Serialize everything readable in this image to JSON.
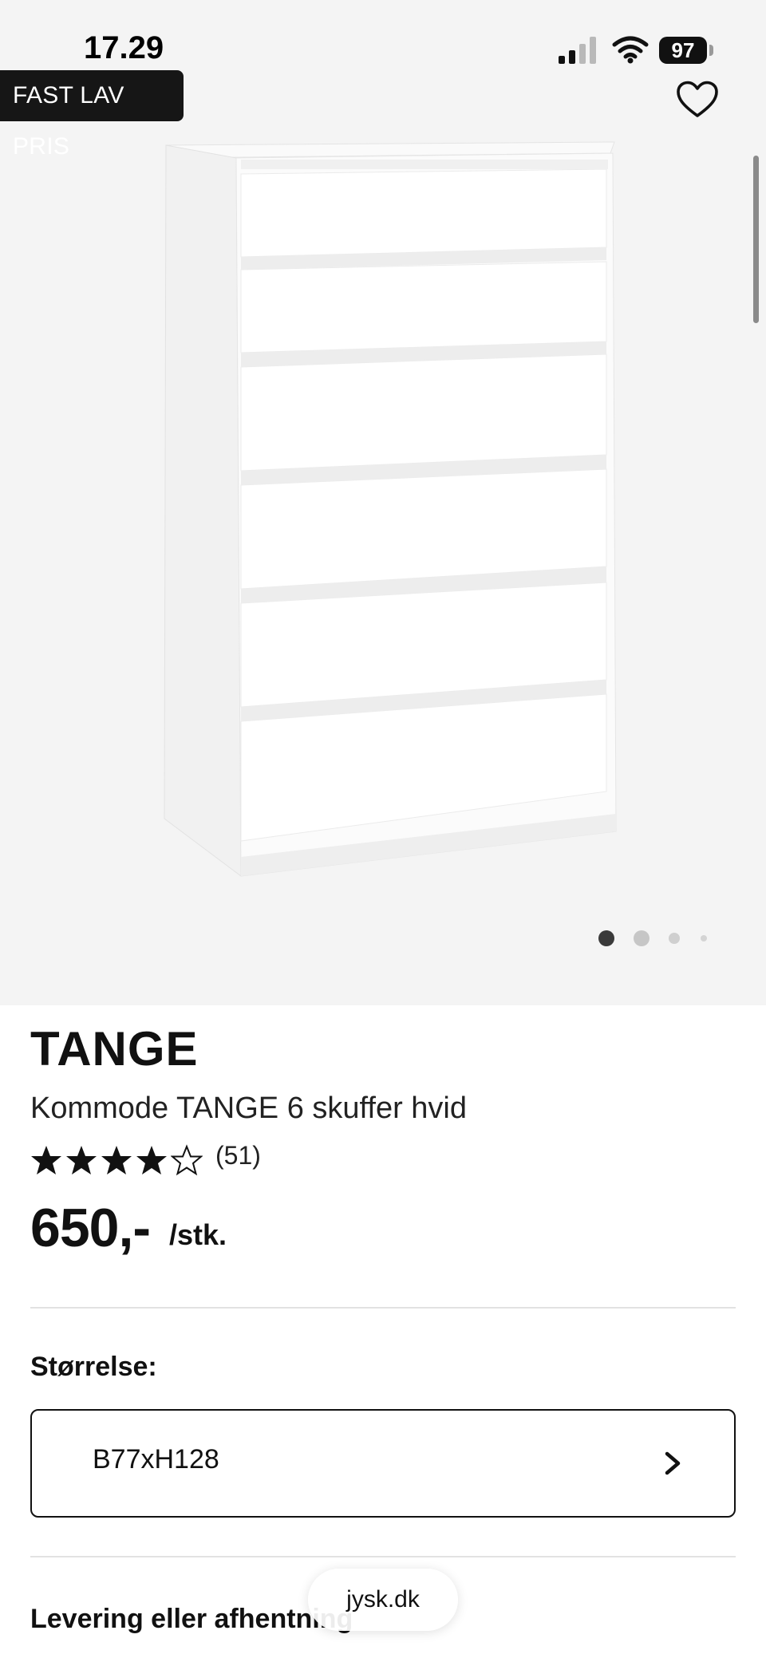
{
  "status_bar": {
    "time": "17.29",
    "battery": "97"
  },
  "badge": {
    "label": "FAST LAV PRIS"
  },
  "icons": {
    "favorite": "heart-outline-icon",
    "signal": "cellular-signal-icon",
    "wifi": "wifi-icon",
    "chevron": "chevron-right-icon"
  },
  "carousel": {
    "slide_count": 4,
    "active_index": 0
  },
  "product": {
    "brand": "TANGE",
    "name": "Kommode TANGE 6 skuffer hvid",
    "rating": 4,
    "rating_max": 5,
    "rating_count": "(51)",
    "price": "650,-",
    "price_unit": "/stk."
  },
  "size": {
    "label": "Størrelse:",
    "value": "B77xH128"
  },
  "delivery": {
    "heading": "Levering eller afhentning"
  },
  "browser": {
    "url": "jysk.dk"
  },
  "colors": {
    "hero_background": "#f4f4f4",
    "badge_background": "#161616",
    "text": "#111111"
  }
}
